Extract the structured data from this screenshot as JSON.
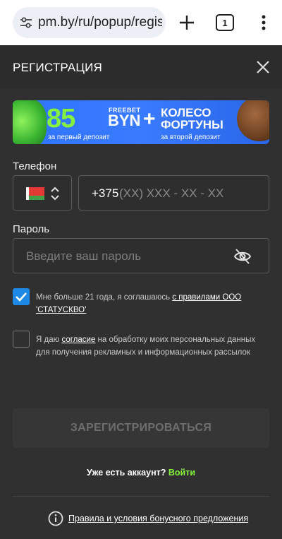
{
  "browser": {
    "url": "pm.by/ru/popup/regis",
    "tab_count": "1",
    "icons": [
      "tune-icon",
      "plus-icon",
      "tabs-icon",
      "more-vert-icon"
    ]
  },
  "modal": {
    "title": "РЕГИСТРАЦИЯ",
    "close_icon": "close-icon"
  },
  "banner": {
    "amount": "85",
    "freebet": "FREEBET",
    "currency": "BYN",
    "plus": "+",
    "wheel_line1": "КОЛЕСО",
    "wheel_line2": "ФОРТУНЫ",
    "sub_left": "за первый депозит",
    "sub_right": "за второй депозит"
  },
  "form": {
    "phone_label": "Телефон",
    "phone_prefix": "+375",
    "phone_mask": "(XX) XXX - XX - XX",
    "country": "BY",
    "password_label": "Пароль",
    "password_placeholder": "Введите ваш пароль"
  },
  "consents": {
    "age": {
      "checked": true,
      "text": "Мне больше 21 года, я соглашаюсь ",
      "link": "с правилами ООО 'СТАТУСКВО'"
    },
    "marketing": {
      "checked": false,
      "text_before": "Я даю ",
      "link": "согласие",
      "text_after": " на обработку моих персональных данных для получения рекламных и информационных рассылок"
    }
  },
  "submit_label": "ЗАРЕГИСТРИРОВАТЬСЯ",
  "login": {
    "prompt": "Уже есть аккаунт? ",
    "link": "Войти"
  },
  "terms_link": "Правила и условия бонусного предложения",
  "colors": {
    "accent_green": "#86f23d",
    "checkbox_blue": "#1e88e5",
    "background": "#303030"
  }
}
